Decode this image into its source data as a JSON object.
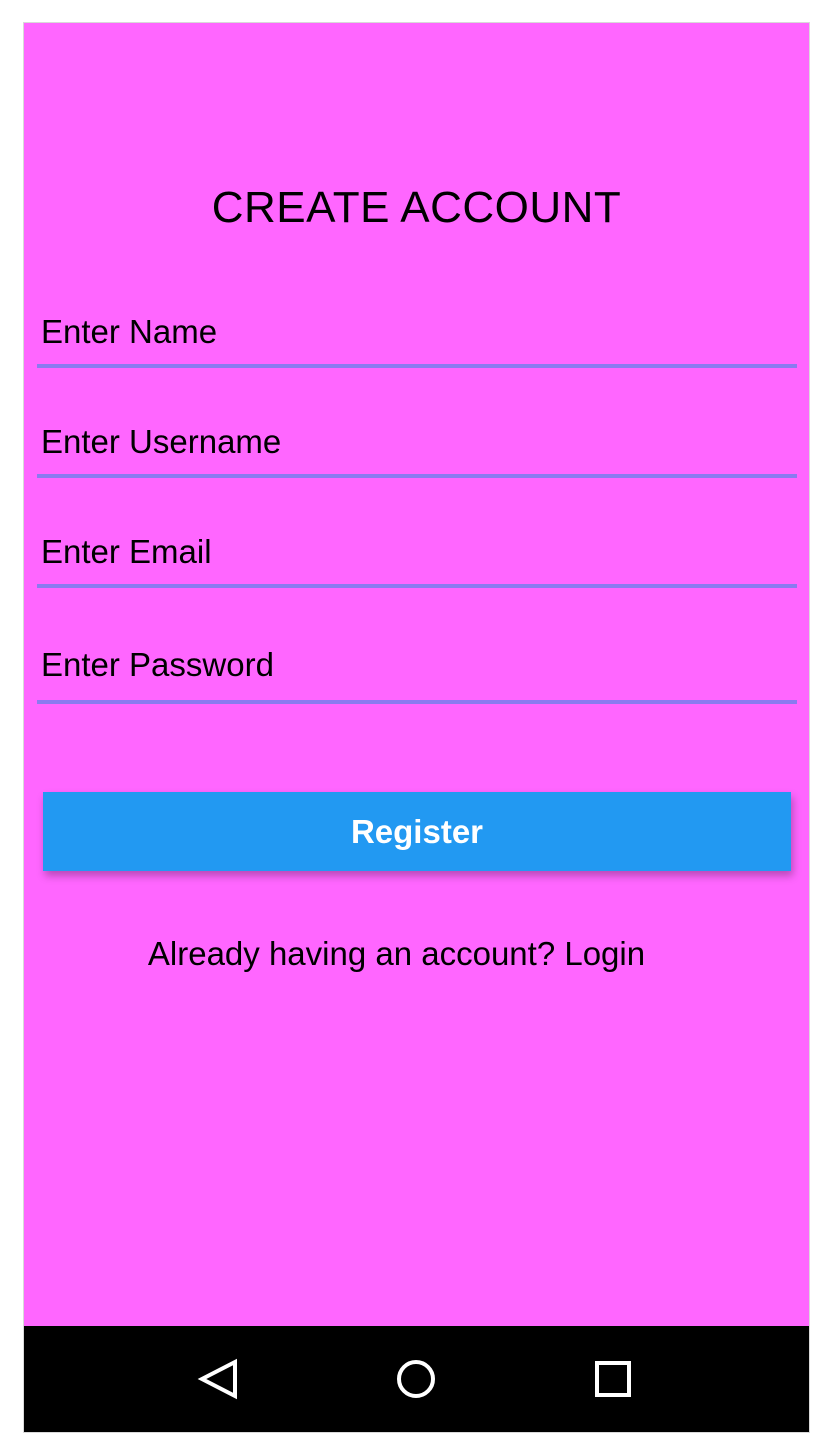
{
  "register_screen": {
    "title": "CREATE ACCOUNT",
    "fields": {
      "name_placeholder": "Enter Name",
      "username_placeholder": "Enter Username",
      "email_placeholder": "Enter Email",
      "password_placeholder": "Enter Password"
    },
    "register_button_label": "Register",
    "login_link_text": "Already having an account? Login"
  },
  "navigation_bar": {
    "back_icon": "back-triangle-icon",
    "home_icon": "home-circle-icon",
    "recents_icon": "recents-square-icon"
  },
  "colors": {
    "background": "#ff66ff",
    "field_underline": "#8a7af0",
    "register_button": "#2299f2",
    "nav_bar": "#000000"
  }
}
